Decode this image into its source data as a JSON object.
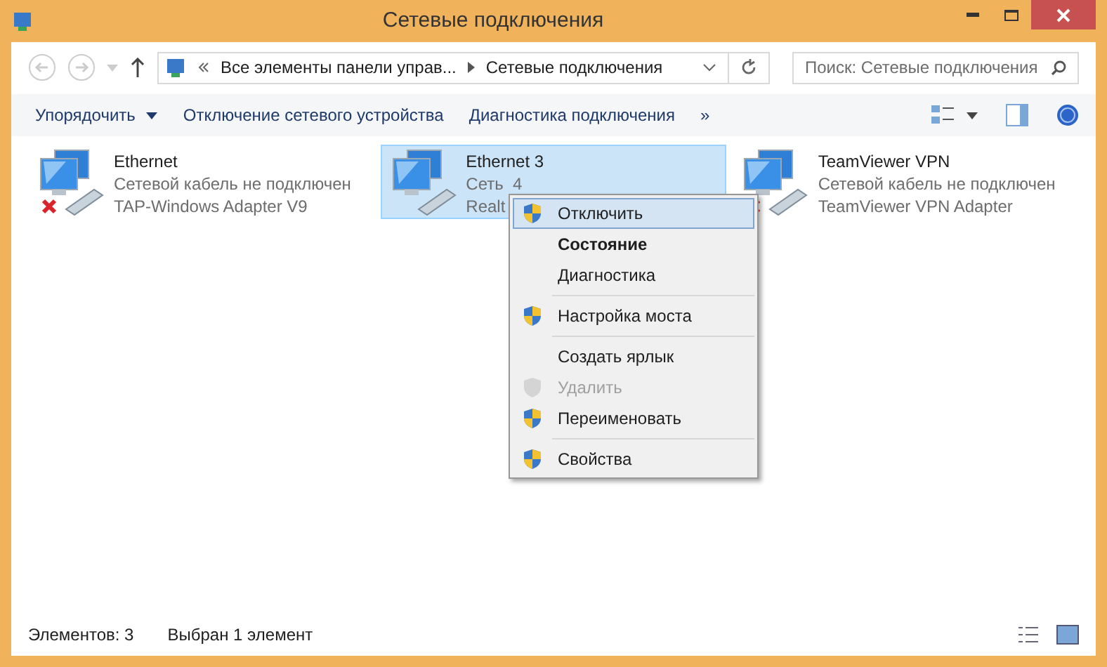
{
  "window": {
    "title": "Сетевые подключения"
  },
  "address": {
    "parent": "Все элементы панели управ...",
    "current": "Сетевые подключения"
  },
  "search": {
    "placeholder": "Поиск: Сетевые подключения"
  },
  "toolbar": [
    {
      "label": "Упорядочить",
      "dropdown": true
    },
    {
      "label": "Отключение сетевого устройства",
      "dropdown": false
    },
    {
      "label": "Диагностика подключения",
      "dropdown": false
    },
    {
      "label": "»",
      "dropdown": false
    }
  ],
  "connections": [
    {
      "name": "Ethernet",
      "status": "Сетевой кабель не подключен",
      "adapter": "TAP-Windows Adapter V9",
      "connected": false,
      "selected": false
    },
    {
      "name": "Ethernet 3",
      "status": "Сеть  4",
      "adapter": "Realt",
      "connected": true,
      "selected": true
    },
    {
      "name": "TeamViewer VPN",
      "status": "Сетевой кабель не подключен",
      "adapter": "TeamViewer VPN Adapter",
      "connected": false,
      "selected": false
    }
  ],
  "context_menu": {
    "groups": [
      [
        {
          "label": "Отключить",
          "shield": true,
          "default": false,
          "disabled": false,
          "selected": true
        },
        {
          "label": "Состояние",
          "shield": false,
          "default": true,
          "disabled": false,
          "selected": false
        },
        {
          "label": "Диагностика",
          "shield": false,
          "default": false,
          "disabled": false,
          "selected": false
        }
      ],
      [
        {
          "label": "Настройка моста",
          "shield": true,
          "default": false,
          "disabled": false,
          "selected": false
        }
      ],
      [
        {
          "label": "Создать ярлык",
          "shield": false,
          "default": false,
          "disabled": false,
          "selected": false
        },
        {
          "label": "Удалить",
          "shield": true,
          "default": false,
          "disabled": true,
          "selected": false
        },
        {
          "label": "Переименовать",
          "shield": true,
          "default": false,
          "disabled": false,
          "selected": false
        }
      ],
      [
        {
          "label": "Свойства",
          "shield": true,
          "default": false,
          "disabled": false,
          "selected": false
        }
      ]
    ]
  },
  "status_bar": {
    "count": "Элементов: 3",
    "selection": "Выбран 1 элемент"
  }
}
